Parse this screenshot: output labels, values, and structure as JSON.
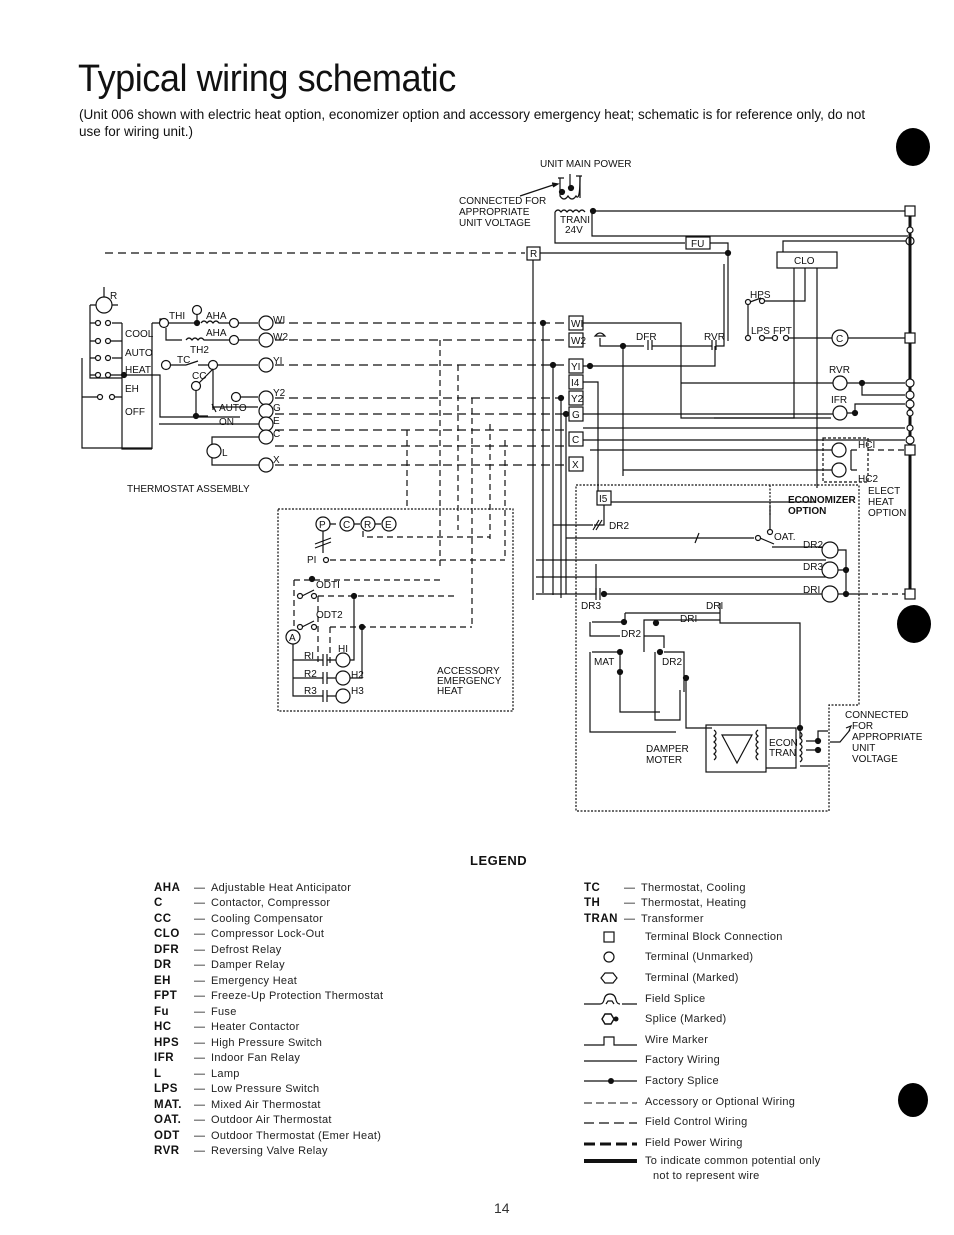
{
  "page": {
    "title": "Typical wiring schematic",
    "subtitle": "(Unit 006 shown with electric heat option, economizer option and accessory emergency heat; schematic is for reference only, do not use for wiring unit.)",
    "page_number": "14"
  },
  "schematic": {
    "power": {
      "unit_main_power": "UNIT MAIN POWER",
      "connected_note": [
        "CONNECTED FOR",
        "APPROPRIATE",
        "UNIT VOLTAGE"
      ],
      "transformer": "TRANI",
      "transformer_voltage": "24V",
      "fuse": "FU",
      "clo": "CLO"
    },
    "thermostat": {
      "title": "THERMOSTAT ASSEMBLY",
      "switch_labels": [
        "COOL",
        "AUTO",
        "HEAT",
        "EH",
        "OFF"
      ],
      "component_labels": [
        "R",
        "THI",
        "AHA",
        "AHA",
        "TH2",
        "TC",
        "CC",
        "AUTO",
        "ON",
        "L"
      ],
      "terminals": [
        "WI",
        "W2",
        "YI",
        "Y2",
        "G",
        "E",
        "C",
        "X"
      ]
    },
    "terminal_block": [
      "R",
      "WI",
      "W2",
      "YI",
      "I4",
      "Y2",
      "G",
      "C",
      "X",
      "I5"
    ],
    "controls": {
      "labels": [
        "HPS",
        "LPS",
        "FPT",
        "DFR",
        "RVR",
        "C",
        "RVR",
        "IFR",
        "HCI",
        "HC2"
      ],
      "elect_heat_option": [
        "ELECT",
        "HEAT",
        "OPTION"
      ]
    },
    "emergency_heat": {
      "title": [
        "ACCESSORY",
        "EMERGENCY",
        "HEAT"
      ],
      "labels": [
        "P",
        "C",
        "R",
        "E",
        "PI",
        "ODTI",
        "ODT2",
        "A",
        "RI",
        "R2",
        "R3",
        "HI",
        "H2",
        "H3"
      ]
    },
    "economizer": {
      "title": [
        "ECONOMIZER",
        "OPTION"
      ],
      "labels": [
        "DR2",
        "OAT.",
        "DR2",
        "DR3",
        "DRI",
        "DR3",
        "DRI",
        "DRI",
        "DR2",
        "MAT",
        "DR2"
      ],
      "damper_motor": [
        "DAMPER",
        "MOTER"
      ],
      "econ_tran": [
        "ECON",
        "TRAN"
      ],
      "connected_note": [
        "CONNECTED",
        "FOR",
        "APPROPRIATE",
        "UNIT",
        "VOLTAGE"
      ]
    }
  },
  "legend": {
    "title": "LEGEND",
    "abbreviations": [
      {
        "abbr": "AHA",
        "def": "Adjustable Heat Anticipator"
      },
      {
        "abbr": "C",
        "def": "Contactor, Compressor"
      },
      {
        "abbr": "CC",
        "def": "Cooling Compensator"
      },
      {
        "abbr": "CLO",
        "def": "Compressor Lock-Out"
      },
      {
        "abbr": "DFR",
        "def": "Defrost Relay"
      },
      {
        "abbr": "DR",
        "def": "Damper Relay"
      },
      {
        "abbr": "EH",
        "def": "Emergency Heat"
      },
      {
        "abbr": "FPT",
        "def": "Freeze-Up Protection Thermostat"
      },
      {
        "abbr": "Fu",
        "def": "Fuse"
      },
      {
        "abbr": "HC",
        "def": "Heater Contactor"
      },
      {
        "abbr": "HPS",
        "def": "High Pressure Switch"
      },
      {
        "abbr": "IFR",
        "def": "Indoor Fan Relay"
      },
      {
        "abbr": "L",
        "def": "Lamp"
      },
      {
        "abbr": "LPS",
        "def": "Low Pressure Switch"
      },
      {
        "abbr": "MAT.",
        "def": "Mixed Air Thermostat"
      },
      {
        "abbr": "OAT.",
        "def": "Outdoor Air Thermostat"
      },
      {
        "abbr": "ODT",
        "def": "Outdoor Thermostat (Emer Heat)"
      },
      {
        "abbr": "RVR",
        "def": "Reversing Valve Relay"
      }
    ],
    "abbreviations_right": [
      {
        "abbr": "TC",
        "def": "Thermostat, Cooling"
      },
      {
        "abbr": "TH",
        "def": "Thermostat, Heating"
      },
      {
        "abbr": "TRAN",
        "def": "Transformer"
      }
    ],
    "symbols": [
      {
        "icon": "terminal-block-icon",
        "label": "Terminal Block Connection"
      },
      {
        "icon": "terminal-unmarked-icon",
        "label": "Terminal (Unmarked)"
      },
      {
        "icon": "terminal-marked-icon",
        "label": "Terminal (Marked)"
      },
      {
        "icon": "field-splice-icon",
        "label": "Field Splice"
      },
      {
        "icon": "splice-marked-icon",
        "label": "Splice (Marked)"
      },
      {
        "icon": "wire-marker-icon",
        "label": "Wire Marker"
      },
      {
        "icon": "factory-wiring-icon",
        "label": "Factory Wiring"
      },
      {
        "icon": "factory-splice-icon",
        "label": "Factory Splice"
      },
      {
        "icon": "accessory-wiring-icon",
        "label": "Accessory or Optional Wiring"
      },
      {
        "icon": "field-control-wiring-icon",
        "label": "Field Control Wiring"
      },
      {
        "icon": "field-power-wiring-icon",
        "label": "Field Power Wiring"
      },
      {
        "icon": "common-potential-icon",
        "label": "To indicate common potential only",
        "label2": "not to represent wire"
      }
    ]
  }
}
